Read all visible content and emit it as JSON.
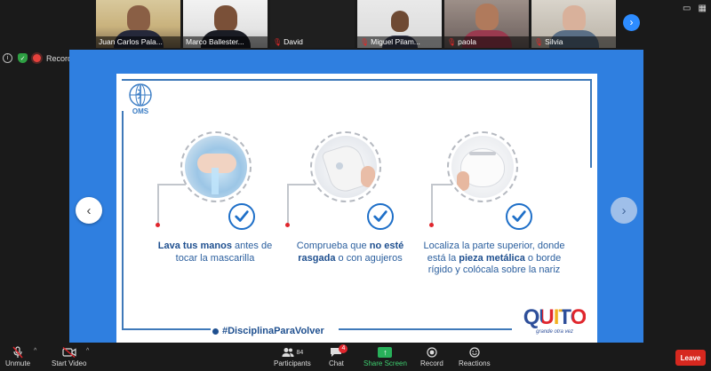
{
  "participants": [
    {
      "name": "Juan Carlos Pala...",
      "muted": false,
      "active": false
    },
    {
      "name": "Marco Ballester...",
      "muted": false,
      "active": true
    },
    {
      "name": "David",
      "muted": true,
      "active": false
    },
    {
      "name": "Miguel Pilam...",
      "muted": true,
      "active": false
    },
    {
      "name": "paola",
      "muted": true,
      "active": false
    },
    {
      "name": "Silvia",
      "muted": true,
      "active": false
    }
  ],
  "status": {
    "recording_label": "Recording"
  },
  "slide": {
    "logo_text": "OMS",
    "captions": [
      {
        "bold1": "Lava tus manos",
        "text1": " antes de tocar la mascarilla"
      },
      {
        "text1": "Comprueba que ",
        "bold1": "no esté rasgada",
        "text2": " o con agujeros"
      },
      {
        "text1": "Localiza la parte superior, donde está la ",
        "bold1": "pieza metálica",
        "text2": " o borde rígido y colócala sobre la nariz"
      }
    ],
    "hashtag": "#DisciplinaParaVolver",
    "brand": "QUITO",
    "brand_tagline": "grande otra vez"
  },
  "toolbar": {
    "unmute": "Unmute",
    "start_video": "Start Video",
    "participants": "Participants",
    "participants_count": "84",
    "chat": "Chat",
    "chat_badge": "4",
    "share_screen": "Share Screen",
    "record": "Record",
    "reactions": "Reactions",
    "leave": "Leave"
  },
  "colors": {
    "accent": "#2d8cff",
    "leave": "#d6281f",
    "share": "#28b05a",
    "slide_blue": "#1e4f8f"
  }
}
